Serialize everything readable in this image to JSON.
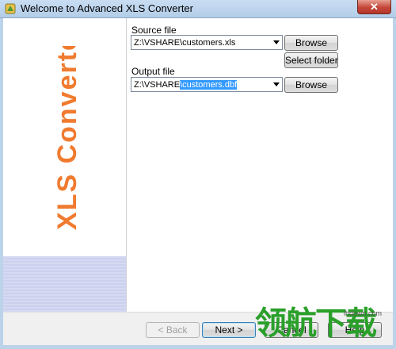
{
  "window": {
    "title": "Welcome to Advanced XLS Converter",
    "close_label": "✕"
  },
  "side_panel": {
    "title": "XLS Converter",
    "title_color": "#f07b2f"
  },
  "source": {
    "label": "Source file",
    "value": "Z:\\VSHARE\\customers.xls",
    "browse_label": "Browse",
    "select_folder_label": "Select folder"
  },
  "output": {
    "label": "Output file",
    "value_prefix": "Z:\\VSHARE",
    "value_selected": "\\customers.dbf",
    "browse_label": "Browse"
  },
  "footer": {
    "back_label": "< Back",
    "next_label": "Next >",
    "cancel_label": "Cancel",
    "help_label": "Help"
  },
  "watermark": {
    "text": "领航下载",
    "url": "lhdown.com"
  }
}
